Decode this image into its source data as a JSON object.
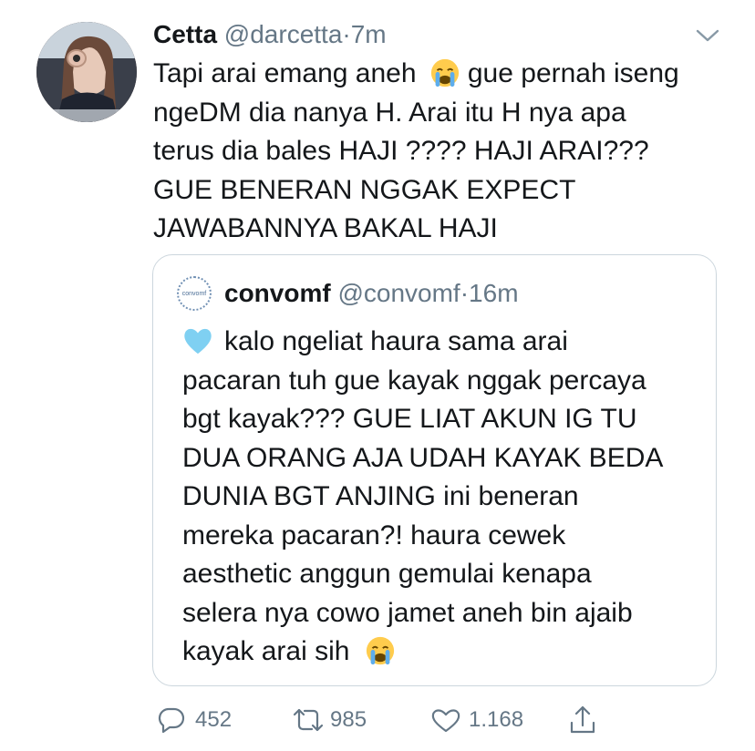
{
  "tweet": {
    "display_name": "Cetta",
    "handle": "@darcetta",
    "separator": "·",
    "time": "7m",
    "text_lines": [
      "Tapi arai emang aneh",
      "gue pernah iseng",
      "ngeDM dia nanya H. Arai itu H nya apa",
      "terus dia bales HAJI ???? HAJI ARAI???",
      "GUE BENERAN NGGAK EXPECT",
      "JAWABANNYA BAKAL HAJI"
    ],
    "emoji": "crying-face"
  },
  "quoted": {
    "display_name": "convomf",
    "handle": "@convomf",
    "separator": "·",
    "time": "16m",
    "avatar_text": "convomf",
    "lead_emoji": "light-blue-heart",
    "text_lines": [
      "kalo ngeliat haura sama arai",
      "pacaran tuh gue kayak nggak percaya",
      "bgt kayak??? GUE LIAT AKUN IG TU",
      "DUA ORANG AJA UDAH KAYAK BEDA",
      "DUNIA BGT ANJING ini beneran",
      "mereka pacaran?! haura cewek",
      "aesthetic anggun gemulai kenapa",
      "selera nya cowo jamet aneh bin ajaib",
      "kayak arai sih"
    ],
    "trail_emoji": "crying-face"
  },
  "actions": {
    "replies": "452",
    "retweets": "985",
    "likes": "1.168"
  },
  "colors": {
    "text": "#14171a",
    "secondary": "#657786",
    "border": "#ccd6dd",
    "heart_emoji": "#7fd0f2"
  }
}
